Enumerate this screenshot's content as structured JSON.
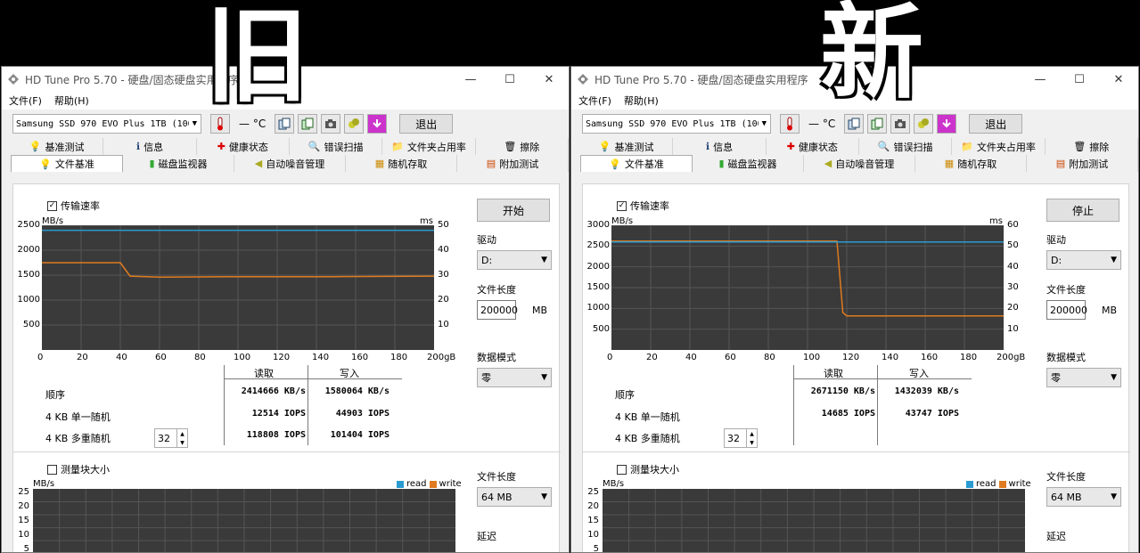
{
  "overlay": {
    "old_label": "旧",
    "new_label": "新"
  },
  "colors": {
    "read": "#2a9bd1",
    "write": "#e07b1f",
    "graph_bg": "#3a3a3a",
    "grid": "#555555"
  },
  "windows": [
    {
      "title": "HD Tune Pro 5.70 - 硬盘/固态硬盘实用程序",
      "menu": [
        "文件(F)",
        "帮助(H)"
      ],
      "drive": "Samsung SSD 970 EVO Plus 1TB (100(",
      "temp": "— °C",
      "exit_label": "退出",
      "tabs_row1": [
        "基准测试",
        "信息",
        "健康状态",
        "错误扫描",
        "文件夹占用率",
        "擦除"
      ],
      "tabs_row2": [
        "文件基准",
        "磁盘监视器",
        "自动噪音管理",
        "随机存取",
        "附加测试"
      ],
      "transfer_rate_label": "传输速率",
      "unit_left": "MB/s",
      "unit_right": "ms",
      "y_left": [
        "2500",
        "2000",
        "1500",
        "1000",
        "500"
      ],
      "y_right": [
        "50",
        "40",
        "30",
        "20",
        "10"
      ],
      "x_ticks": [
        "0",
        "20",
        "40",
        "60",
        "80",
        "100",
        "120",
        "140",
        "160",
        "180",
        "200gB"
      ],
      "results": {
        "read_head": "读取",
        "write_head": "写入",
        "rows": [
          {
            "label": "顺序",
            "read": "2414666 KB/s",
            "write": "1580064 KB/s"
          },
          {
            "label": "4 KB 单一随机",
            "read": "12514 IOPS",
            "write": "44903 IOPS"
          },
          {
            "label": "4 KB 多重随机",
            "read": "118808 IOPS",
            "write": "101404 IOPS"
          }
        ],
        "queue_depth": "32"
      },
      "side": {
        "action_button": "开始",
        "drive_label": "驱动",
        "drive_value": "D:",
        "file_len_label": "文件长度",
        "file_len_value": "200000",
        "file_len_unit": "MB",
        "data_mode_label": "数据模式",
        "data_mode_value": "零"
      },
      "block": {
        "label": "测量块大小",
        "unit": "MB/s",
        "legend_read": "read",
        "legend_write": "write",
        "y": [
          "25",
          "20",
          "15",
          "10",
          "5"
        ],
        "file_len_label": "文件长度",
        "file_len_value": "64 MB",
        "latency_label": "延迟"
      }
    },
    {
      "title": "HD Tune Pro 5.70 - 硬盘/固态硬盘实用程序",
      "menu": [
        "文件(F)",
        "帮助(H)"
      ],
      "drive": "Samsung SSD 970 EVO Plus 1TB (100(",
      "temp": "— °C",
      "exit_label": "退出",
      "tabs_row1": [
        "基准测试",
        "信息",
        "健康状态",
        "错误扫描",
        "文件夹占用率",
        "擦除"
      ],
      "tabs_row2": [
        "文件基准",
        "磁盘监视器",
        "自动噪音管理",
        "随机存取",
        "附加测试"
      ],
      "transfer_rate_label": "传输速率",
      "unit_left": "MB/s",
      "unit_right": "ms",
      "y_left": [
        "3000",
        "2500",
        "2000",
        "1500",
        "1000",
        "500"
      ],
      "y_right": [
        "60",
        "50",
        "40",
        "30",
        "20",
        "10"
      ],
      "x_ticks": [
        "0",
        "20",
        "40",
        "60",
        "80",
        "100",
        "120",
        "140",
        "160",
        "180",
        "200gB"
      ],
      "results": {
        "read_head": "读取",
        "write_head": "写入",
        "rows": [
          {
            "label": "顺序",
            "read": "2671150 KB/s",
            "write": "1432039 KB/s"
          },
          {
            "label": "4 KB 单一随机",
            "read": "14685 IOPS",
            "write": "43747 IOPS"
          },
          {
            "label": "4 KB 多重随机",
            "read": "",
            "write": ""
          }
        ],
        "queue_depth": "32"
      },
      "side": {
        "action_button": "停止",
        "drive_label": "驱动",
        "drive_value": "D:",
        "file_len_label": "文件长度",
        "file_len_value": "200000",
        "file_len_unit": "MB",
        "data_mode_label": "数据模式",
        "data_mode_value": "零"
      },
      "block": {
        "label": "测量块大小",
        "unit": "MB/s",
        "legend_read": "read",
        "legend_write": "write",
        "y": [
          "25",
          "20",
          "15",
          "10",
          "5"
        ],
        "file_len_label": "文件长度",
        "file_len_value": "64 MB",
        "latency_label": "延迟"
      }
    }
  ],
  "chart_data": [
    {
      "type": "line",
      "xlim": [
        0,
        200
      ],
      "ylim": [
        0,
        2500
      ],
      "series": [
        {
          "name": "write",
          "x": [
            0,
            40,
            45,
            60,
            100,
            150,
            200
          ],
          "values": [
            1750,
            1750,
            1480,
            1460,
            1470,
            1470,
            1480
          ]
        },
        {
          "name": "read",
          "x": [
            0,
            200
          ],
          "values": [
            2400,
            2400
          ]
        }
      ]
    },
    {
      "type": "line",
      "xlim": [
        0,
        200
      ],
      "ylim": [
        0,
        3000
      ],
      "series": [
        {
          "name": "write",
          "x": [
            0,
            115,
            118,
            120,
            200
          ],
          "values": [
            2620,
            2620,
            900,
            820,
            820
          ]
        },
        {
          "name": "read",
          "x": [
            0,
            200
          ],
          "values": [
            2600,
            2600
          ]
        }
      ]
    }
  ]
}
